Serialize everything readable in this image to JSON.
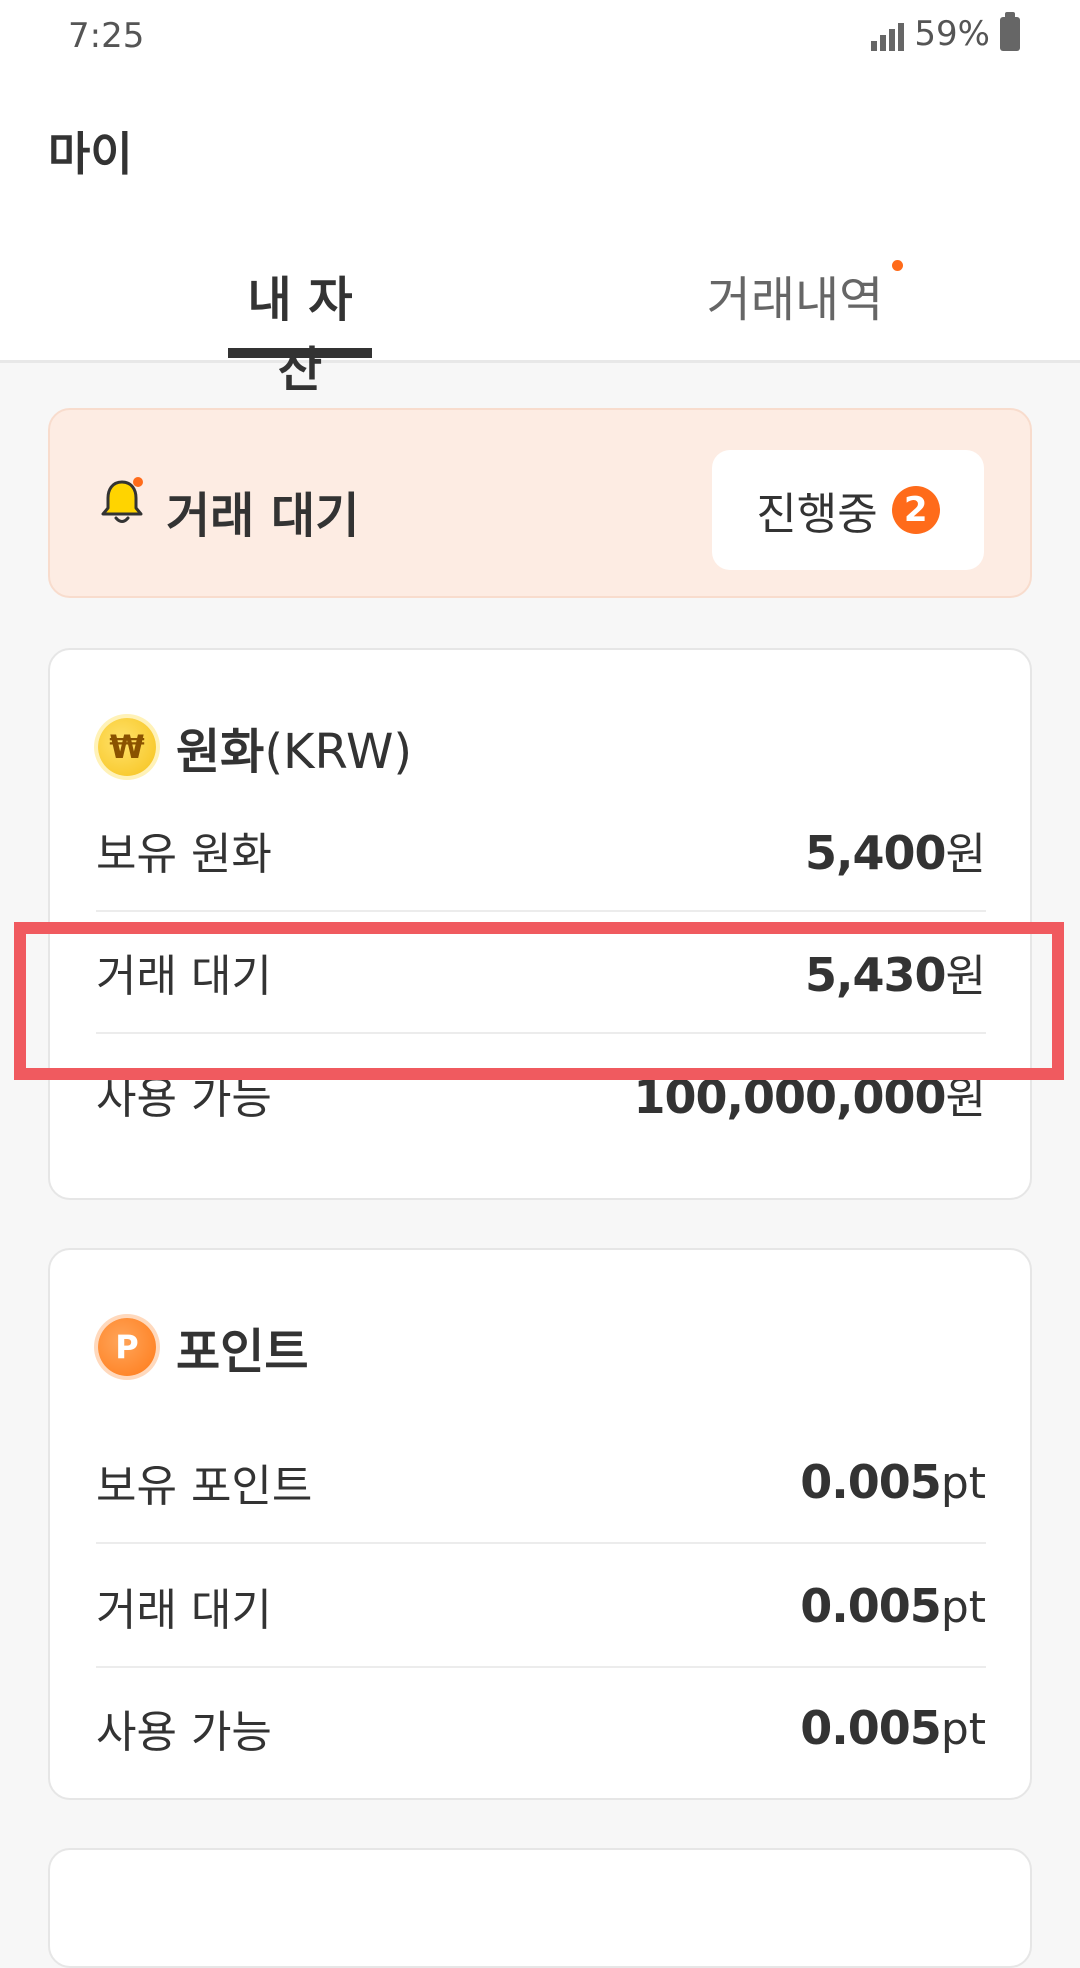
{
  "status_bar": {
    "time": "7:25",
    "battery": "59%"
  },
  "header": {
    "title": "마이",
    "tabs": [
      {
        "label": "내 자산",
        "active": true
      },
      {
        "label": "거래내역",
        "active": false,
        "has_dot": true
      }
    ]
  },
  "pending_banner": {
    "title": "거래 대기",
    "button_label": "진행중",
    "count": "2"
  },
  "krw_card": {
    "icon_glyph": "₩",
    "title": "원화",
    "title_suffix": "(KRW)",
    "rows": [
      {
        "label": "보유 원화",
        "value": "5,400",
        "unit": "원"
      },
      {
        "label": "거래 대기",
        "value": "5,430",
        "unit": "원"
      },
      {
        "label": "사용 가능",
        "value": "100,000,000",
        "unit": "원"
      }
    ]
  },
  "point_card": {
    "icon_glyph": "P",
    "title": "포인트",
    "rows": [
      {
        "label": "보유 포인트",
        "value": "0.005",
        "unit": "pt"
      },
      {
        "label": "거래 대기",
        "value": "0.005",
        "unit": "pt"
      },
      {
        "label": "사용 가능",
        "value": "0.005",
        "unit": "pt"
      }
    ]
  },
  "colors": {
    "accent": "#ff6b1a",
    "highlight": "#f05a5f",
    "banner_bg": "#fdece3"
  }
}
